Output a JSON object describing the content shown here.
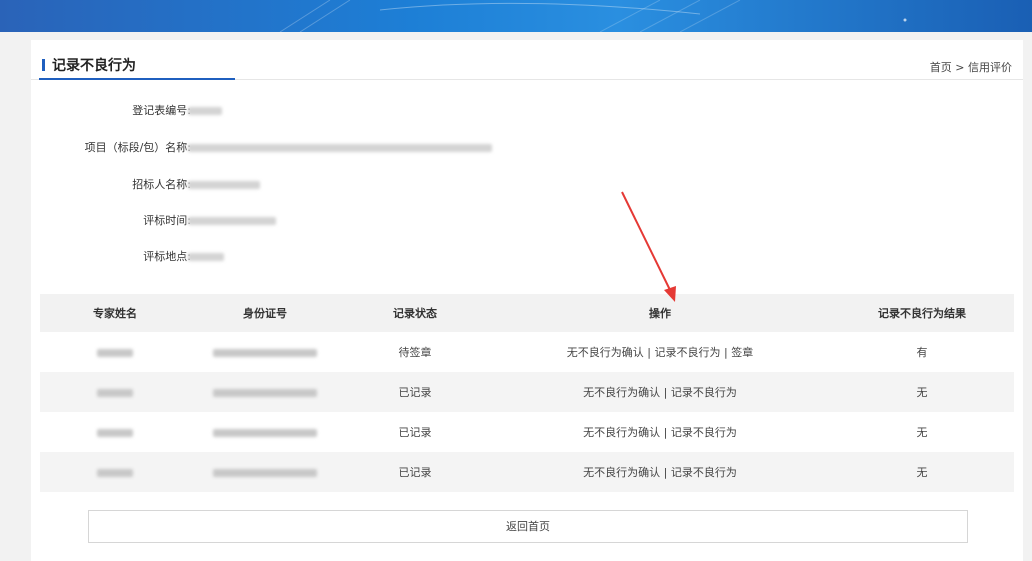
{
  "page": {
    "title": "记录不良行为",
    "breadcrumb": "首页 > 信用评价"
  },
  "info": [
    {
      "label": "登记表编号:"
    },
    {
      "label": "项目（标段/包）名称:"
    },
    {
      "label": "招标人名称:"
    },
    {
      "label": "评标时间:"
    },
    {
      "label": "评标地点:"
    }
  ],
  "table": {
    "headers": [
      "专家姓名",
      "身份证号",
      "记录状态",
      "操作",
      "记录不良行为结果"
    ],
    "rows": [
      {
        "status": "待签章",
        "actions": "无不良行为确认 | 记录不良行为 | 签章",
        "result": "有"
      },
      {
        "status": "已记录",
        "actions": "无不良行为确认 | 记录不良行为",
        "result": "无"
      },
      {
        "status": "已记录",
        "actions": "无不良行为确认 | 记录不良行为",
        "result": "无"
      },
      {
        "status": "已记录",
        "actions": "无不良行为确认 | 记录不良行为",
        "result": "无"
      }
    ]
  },
  "buttons": {
    "back": "返回首页"
  },
  "colors": {
    "accent": "#1f5fbf",
    "annotation_arrow": "#e53935"
  }
}
